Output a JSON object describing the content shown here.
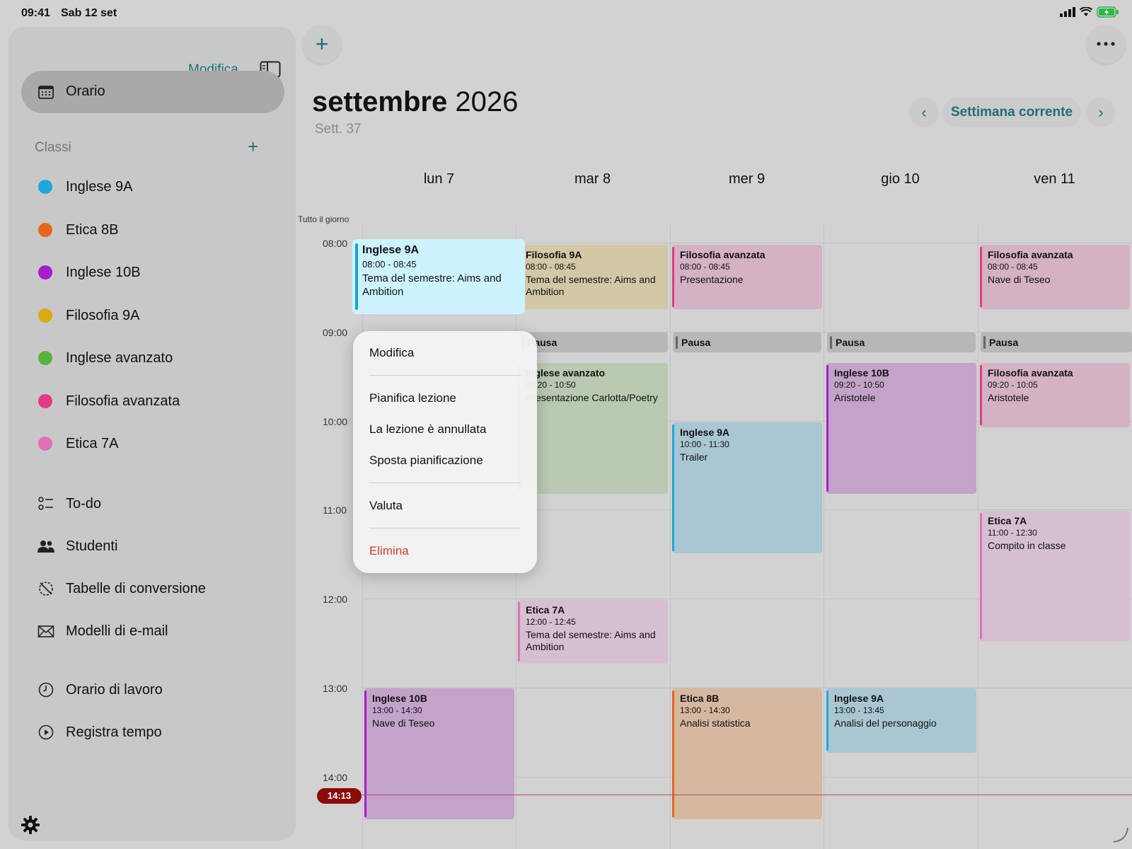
{
  "status": {
    "time": "09:41",
    "date": "Sab 12 set"
  },
  "sidebar": {
    "edit_label": "Modifica",
    "orario_label": "Orario",
    "classes_header": "Classi",
    "classes": [
      {
        "name": "Inglese 9A",
        "color": "#1ea7dd"
      },
      {
        "name": "Etica 8B",
        "color": "#e4661f"
      },
      {
        "name": "Inglese 10B",
        "color": "#a61ccf"
      },
      {
        "name": "Filosofia 9A",
        "color": "#dcaa14"
      },
      {
        "name": "Inglese avanzato",
        "color": "#58b43c"
      },
      {
        "name": "Filosofia avanzata",
        "color": "#e43a84"
      },
      {
        "name": "Etica 7A",
        "color": "#e070b8"
      }
    ],
    "tools": [
      {
        "label": "To-do",
        "icon": "todo-list-icon"
      },
      {
        "label": "Studenti",
        "icon": "people-icon"
      },
      {
        "label": "Tabelle di conversione",
        "icon": "conversion-icon"
      },
      {
        "label": "Modelli di e-mail",
        "icon": "envelope-icon"
      }
    ],
    "work": [
      {
        "label": "Orario di lavoro",
        "icon": "clock-icon"
      },
      {
        "label": "Registra tempo",
        "icon": "play-circle-icon"
      }
    ]
  },
  "header": {
    "month": "settembre",
    "year": "2026",
    "week": "Sett. 37",
    "current_week_label": "Settimana corrente"
  },
  "days": [
    "lun 7",
    "mar 8",
    "mer 9",
    "gio 10",
    "ven 11"
  ],
  "all_day_label": "Tutto il giorno",
  "hours": [
    "08:00",
    "09:00",
    "10:00",
    "11:00",
    "12:00",
    "13:00",
    "14:00"
  ],
  "now_label": "14:13",
  "pause_label": "Pausa",
  "events": {
    "mon_1": {
      "title": "Inglese 9A",
      "time": "08:00 - 08:45",
      "desc": "Tema del semestre: Aims and Ambition"
    },
    "mon_2": {
      "title": "Inglese 10B",
      "time": "13:00 - 14:30",
      "desc": "Nave di Teseo"
    },
    "tue_1": {
      "title": "Filosofia 9A",
      "time": "08:00 - 08:45",
      "desc": "Tema del semestre: Aims and Ambition"
    },
    "tue_2": {
      "title": "Inglese avanzato",
      "time": "09:20 - 10:50",
      "desc": "Presentazione Carlotta/Poetry"
    },
    "tue_3": {
      "title": "Etica 7A",
      "time": "12:00 - 12:45",
      "desc": "Tema del semestre: Aims and Ambition"
    },
    "wed_1": {
      "title": "Filosofia avanzata",
      "time": "08:00 - 08:45",
      "desc": "Presentazione"
    },
    "wed_2": {
      "title": "Inglese 9A",
      "time": "10:00 - 11:30",
      "desc": "Trailer"
    },
    "wed_3": {
      "title": "Etica 8B",
      "time": "13:00 - 14:30",
      "desc": "Analisi statistica"
    },
    "thu_1": {
      "title": "Inglese 10B",
      "time": "09:20 - 10:50",
      "desc": "Aristotele"
    },
    "thu_2": {
      "title": "Inglese 9A",
      "time": "13:00 - 13:45",
      "desc": "Analisi del personaggio"
    },
    "fri_1": {
      "title": "Filosofia avanzata",
      "time": "08:00 - 08:45",
      "desc": "Nave di Teseo"
    },
    "fri_2": {
      "title": "Filosofia avanzata",
      "time": "09:20 - 10:05",
      "desc": "Aristotele"
    },
    "fri_3": {
      "title": "Etica 7A",
      "time": "11:00 - 12:30",
      "desc": "Compito in classe"
    }
  },
  "context_menu": {
    "edit": "Modifica",
    "plan": "Pianifica lezione",
    "cancelled": "La lezione è annullata",
    "move": "Sposta pianificazione",
    "grade": "Valuta",
    "delete": "Elimina"
  }
}
